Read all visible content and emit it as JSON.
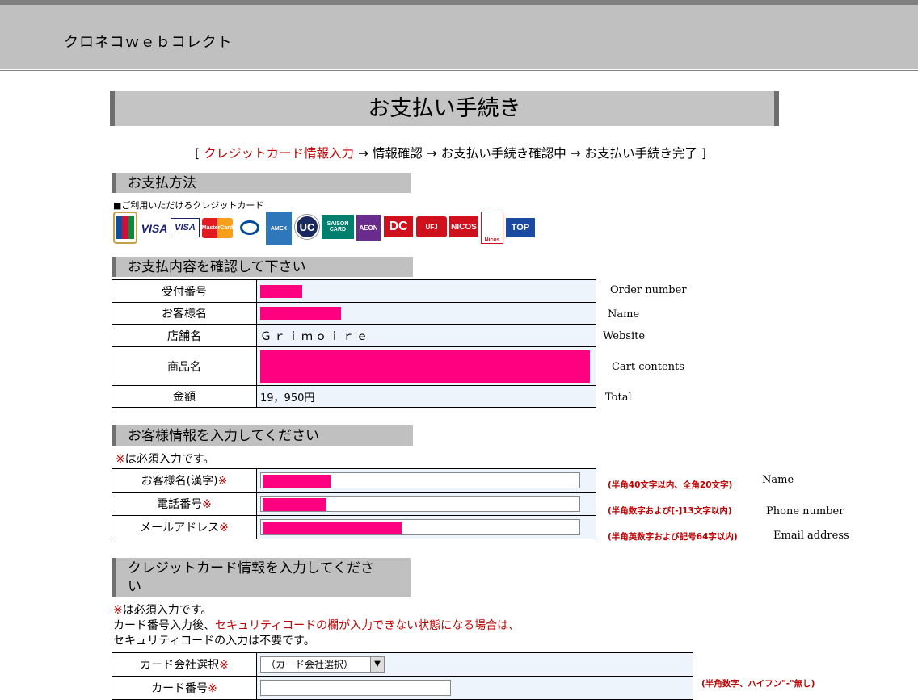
{
  "header": {
    "brand": "クロネコｗｅｂコレクト"
  },
  "page_title": "お支払い手続き",
  "steps": {
    "open": "[",
    "current": "クレジットカード情報入力",
    "rest": " → 情報確認 → お支払い手続き確認中 → お支払い手続き完了 ",
    "close": "]"
  },
  "payment_method": {
    "heading": "お支払方法",
    "cards_label": "■ご利用いただけるクレジットカード",
    "cards": [
      "JCB",
      "VISA",
      "VISA",
      "MasterCard",
      "Diners Club",
      "AMEX",
      "UC",
      "SAISON CARD",
      "AEON",
      "DC",
      "UFJ",
      "NICOS",
      "Nicos",
      "TOP"
    ]
  },
  "confirm": {
    "heading": "お支払内容を確認して下さい",
    "rows": [
      {
        "label": "受付番号",
        "value": "",
        "en": "Order number"
      },
      {
        "label": "お客様名",
        "value": "",
        "en": "Name"
      },
      {
        "label": "店舗名",
        "value": "Ｇｒｉｍｏｉｒｅ",
        "en": "Website"
      },
      {
        "label": "商品名",
        "value": "",
        "en": "Cart contents"
      },
      {
        "label": "金額",
        "value": "19，950円",
        "en": "Total"
      }
    ]
  },
  "customer": {
    "heading": "お客様情報を入力してください",
    "required_mark": "※",
    "required_text": "は必須入力です。",
    "rows": [
      {
        "label": "お客様名(漢字)",
        "note": "(半角40文字以内、全角20文字)",
        "en": "Name"
      },
      {
        "label": "電話番号",
        "note": "(半角数字および[-]13文字以内)",
        "en": "Phone number"
      },
      {
        "label": "メールアドレス",
        "note": "(半角英数字および記号64字以内)",
        "en": "Email address"
      }
    ]
  },
  "card_info": {
    "heading_line1": "クレジットカード情報を入力してくださ",
    "heading_line2": "い",
    "required_mark": "※",
    "required_text": "は必須入力です。",
    "notice_prefix": "カード番号入力後、",
    "notice_red": "セキュリティコードの欄が入力できない状態になる場合は、",
    "notice_line2": "セキュリティコードの入力は不要です。",
    "rows": [
      {
        "label": "カード会社選択",
        "select_value": "（カード会社選択）"
      },
      {
        "label": "カード番号",
        "note": "(半角数字、ハイフン\"-\"無し)"
      }
    ]
  }
}
